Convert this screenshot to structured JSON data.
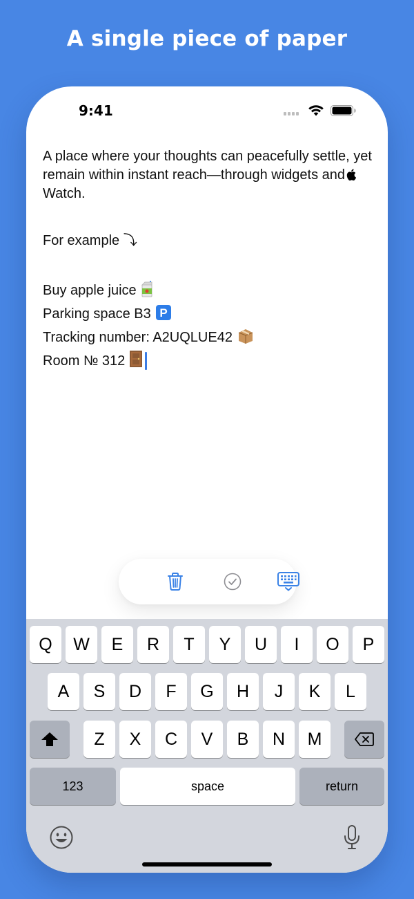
{
  "headline": "A single piece of paper",
  "status_bar": {
    "time": "9:41"
  },
  "note": {
    "intro_part1": "A place where your thoughts can peacefully settle, yet remain within instant reach—through widgets and",
    "intro_part2": "Watch.",
    "example_label": "For example ⤵",
    "items": [
      {
        "text": "Buy apple juice",
        "emoji": "🧃"
      },
      {
        "text": "Parking space B3",
        "emoji": "🅿️"
      },
      {
        "text": "Tracking number: A2UQLUE42",
        "emoji": "📦"
      },
      {
        "text": "Room № 312",
        "emoji": "🚪"
      }
    ]
  },
  "actions": [
    "trash-icon",
    "checkmark-icon",
    "keyboard-dismiss-icon"
  ],
  "keyboard": {
    "row1": [
      "Q",
      "W",
      "E",
      "R",
      "T",
      "Y",
      "U",
      "I",
      "O",
      "P"
    ],
    "row2": [
      "A",
      "S",
      "D",
      "F",
      "G",
      "H",
      "J",
      "K",
      "L"
    ],
    "row3": [
      "Z",
      "X",
      "C",
      "V",
      "B",
      "N",
      "M"
    ],
    "numbers_label": "123",
    "space_label": "space",
    "return_label": "return"
  },
  "colors": {
    "background": "#4886e4",
    "accent": "#3b7de6",
    "keyboard_bg": "#d3d6dd",
    "special_key": "#acb1bb"
  }
}
